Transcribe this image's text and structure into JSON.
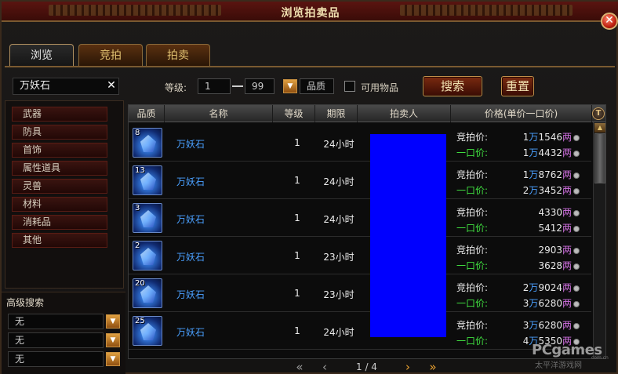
{
  "window": {
    "title": "浏览拍卖品"
  },
  "tabs": [
    "浏览",
    "竞拍",
    "拍卖"
  ],
  "filters": {
    "search_value": "万妖石",
    "level_label": "等级:",
    "level_min": "1",
    "level_max": "99",
    "quality_label": "品质",
    "usable_label": "可用物品",
    "search_button": "搜索",
    "reset_button": "重置"
  },
  "categories": [
    "武器",
    "防具",
    "首饰",
    "属性道具",
    "灵兽",
    "材料",
    "消耗品",
    "其他"
  ],
  "advanced": {
    "title": "高级搜索",
    "selects": [
      "无",
      "无",
      "无"
    ]
  },
  "table": {
    "headers": [
      "品质",
      "名称",
      "等级",
      "期限",
      "拍卖人",
      "价格(单价一口价)"
    ],
    "bid_label": "竞拍价:",
    "buyout_label": "一口价:",
    "rows": [
      {
        "qty": "8",
        "name": "万妖石",
        "level": "1",
        "duration": "24小时",
        "bid_wan": "1",
        "bid_liang": "1546",
        "buy_wan": "1",
        "buy_liang": "4432"
      },
      {
        "qty": "13",
        "name": "万妖石",
        "level": "1",
        "duration": "24小时",
        "bid_wan": "1",
        "bid_liang": "8762",
        "buy_wan": "2",
        "buy_liang": "3452"
      },
      {
        "qty": "3",
        "name": "万妖石",
        "level": "1",
        "duration": "24小时",
        "bid_wan": "",
        "bid_liang": "4330",
        "buy_wan": "",
        "buy_liang": "5412"
      },
      {
        "qty": "2",
        "name": "万妖石",
        "level": "1",
        "duration": "23小时",
        "bid_wan": "",
        "bid_liang": "2903",
        "buy_wan": "",
        "buy_liang": "3628"
      },
      {
        "qty": "20",
        "name": "万妖石",
        "level": "1",
        "duration": "23小时",
        "bid_wan": "2",
        "bid_liang": "9024",
        "buy_wan": "3",
        "buy_liang": "6280"
      },
      {
        "qty": "25",
        "name": "万妖石",
        "level": "1",
        "duration": "24小时",
        "bid_wan": "3",
        "bid_liang": "6280",
        "buy_wan": "4",
        "buy_liang": "5350"
      }
    ],
    "wan_unit": "万",
    "liang_unit": "两"
  },
  "pager": {
    "text": "1 / 4"
  },
  "watermark": {
    "brand": "PCgames",
    "sub": "太平洋游戏网",
    "domain": "com.cn"
  },
  "colors": {
    "accent_gold": "#e8a030",
    "name_blue": "#4aa0ff",
    "buyout_green": "#40e040",
    "seller_block": "#0000ff"
  }
}
